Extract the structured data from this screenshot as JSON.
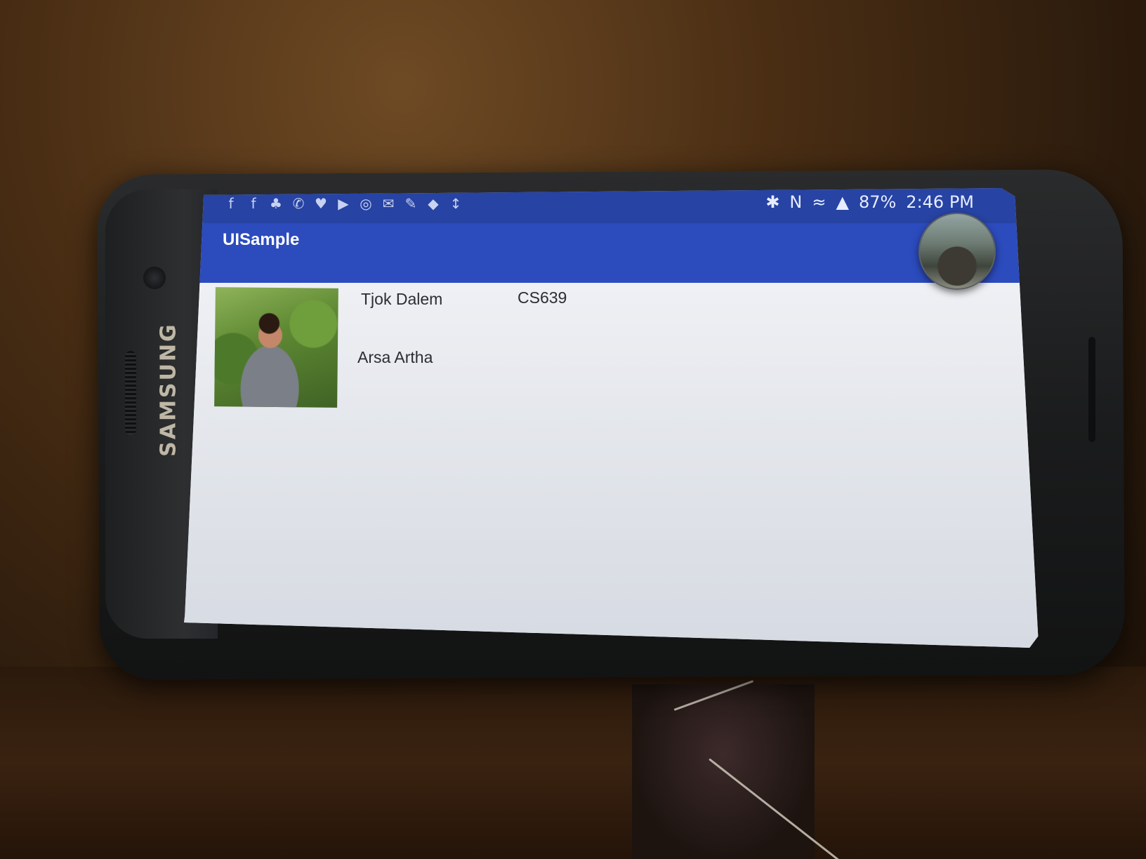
{
  "statusbar": {
    "notification_icons": [
      "f",
      "f",
      "♣",
      "✆",
      "♥",
      "▶",
      "◎",
      "✉",
      "✎",
      "◆",
      "↕"
    ],
    "bluetooth": "✱",
    "nfc": "N",
    "wifi": "≈",
    "signal": "▲",
    "battery": "87%",
    "time": "2:46 PM"
  },
  "appbar": {
    "title": "UISample"
  },
  "profile": {
    "first_name": "Tjok Dalem",
    "course": "CS639",
    "last_name": "Arsa Artha"
  },
  "device": {
    "brand": "SAMSUNG"
  }
}
